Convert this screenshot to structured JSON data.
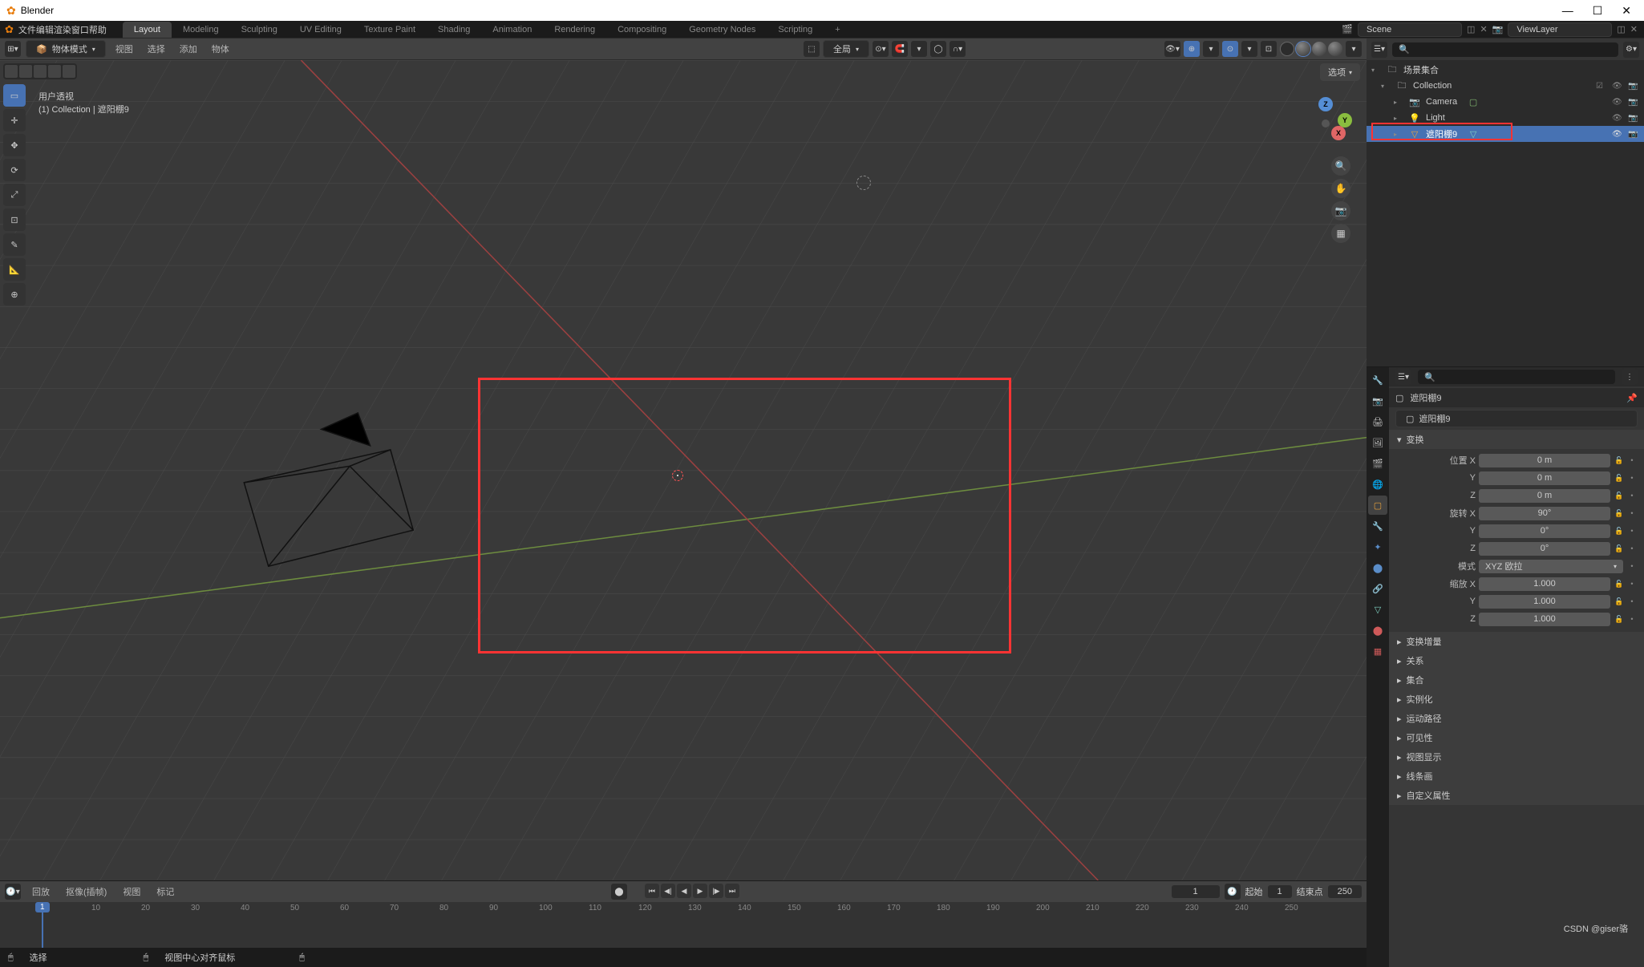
{
  "app_title": "Blender",
  "menus": [
    "文件",
    "编辑",
    "渲染",
    "窗口",
    "帮助"
  ],
  "workspaces": [
    "Layout",
    "Modeling",
    "Sculpting",
    "UV Editing",
    "Texture Paint",
    "Shading",
    "Animation",
    "Rendering",
    "Compositing",
    "Geometry Nodes",
    "Scripting"
  ],
  "active_workspace": "Layout",
  "scene_label": "Scene",
  "view_layer_label": "ViewLayer",
  "mode_label": "物体模式",
  "vp_menus": [
    "视图",
    "选择",
    "添加",
    "物体"
  ],
  "orientation_label": "全局",
  "options_label": "选项",
  "overlay_title": "用户透视",
  "overlay_subtitle": "(1) Collection | 遮阳棚9",
  "outliner_root": "场景集合",
  "outliner": {
    "collection": "Collection",
    "items": [
      "Camera",
      "Light",
      "遮阳棚9"
    ]
  },
  "props_name1": "遮阳棚9",
  "props_name2": "遮阳棚9",
  "transform": {
    "header": "变换",
    "loc_label": "位置 X",
    "loc_x": "0 m",
    "loc_y": "0 m",
    "loc_z": "0 m",
    "rot_label": "旋转 X",
    "rot_x": "90°",
    "rot_y": "0°",
    "rot_z": "0°",
    "mode_label": "模式",
    "mode_value": "XYZ 欧拉",
    "scale_label": "缩放 X",
    "scale_x": "1.000",
    "scale_y": "1.000",
    "scale_z": "1.000"
  },
  "panels": [
    "变换增量",
    "关系",
    "集合",
    "实例化",
    "运动路径",
    "可见性",
    "视图显示",
    "线条画",
    "自定义属性"
  ],
  "timeline": {
    "menus": [
      "回放",
      "抠像(插帧)",
      "视图",
      "标记"
    ],
    "current": "1",
    "start_label": "起始",
    "start": "1",
    "end_label": "结束点",
    "end": "250",
    "ticks": [
      10,
      20,
      30,
      40,
      50,
      60,
      70,
      80,
      90,
      100,
      110,
      120,
      130,
      140,
      150,
      160,
      170,
      180,
      190,
      200,
      210,
      220,
      230,
      240,
      250
    ]
  },
  "status": {
    "select": "选择",
    "center": "视图中心对齐鼠标"
  },
  "watermark": "CSDN @giser骆"
}
